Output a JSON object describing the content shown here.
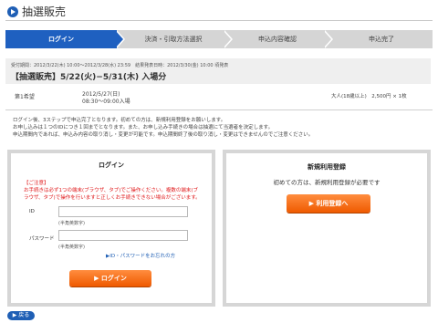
{
  "header": {
    "title": "抽選販売",
    "icon": "circle-arrow-icon"
  },
  "steps": [
    {
      "label": "ログイン",
      "active": true
    },
    {
      "label": "決済・引取方法選択",
      "active": false
    },
    {
      "label": "申込内容確認",
      "active": false
    },
    {
      "label": "申込完了",
      "active": false
    }
  ],
  "info": {
    "period_line": "受付期間：2012/3/22(木) 10:00〜2012/3/28(水) 23:59　結果発表日時：2012/3/30(金) 10:00 頃発表",
    "event_title": "【抽選販売】5/22(火)−5/31(木) 入場分"
  },
  "performance": {
    "choice_label": "第1希望",
    "date": "2012/5/27(日)",
    "time": "08:30〜09:00入場",
    "price": "大人(18歳以上)　2,500円 × 1枚"
  },
  "description": [
    "ログイン後、3ステップで申込完了となります。初めての方は、新規利用登録をお願いします。",
    "お申し込みは１つのIDにつき１回までとなります。また、お申し込み手続きの場合は抽選にて当選者を決定します。",
    "申込期間内であれば、申込み内容の取り消し・変更が可能です。申込期間終了後の取り消し・変更はできませんのでご注意ください。"
  ],
  "login": {
    "title": "ログイン",
    "warning_title": "【ご注意】",
    "warning_lines": [
      "お手続きは必ず1つの端末(ブラウザ、タブ)でご操作ください。複数の端末(ブ",
      "ラウザ、タブ)で操作を行いますと正しくお手続きできない場合がございます。"
    ],
    "id_label": "ID",
    "id_value": "",
    "id_note": "(半角英数字)",
    "password_label": "パスワード",
    "password_value": "",
    "password_note": "(半角英数字)",
    "forgot_link": "▶ID・パスワードをお忘れの方",
    "submit_label": "▶ ログイン"
  },
  "register": {
    "title": "新規利用登録",
    "subtitle": "初めての方は、新規利用登録が必要です",
    "button_label": "▶ 利用登録へ"
  },
  "back_label": "▶ 戻る",
  "colors": {
    "accent": "#1f60c0",
    "button": "#ef5a00",
    "warning": "#e0191b"
  }
}
